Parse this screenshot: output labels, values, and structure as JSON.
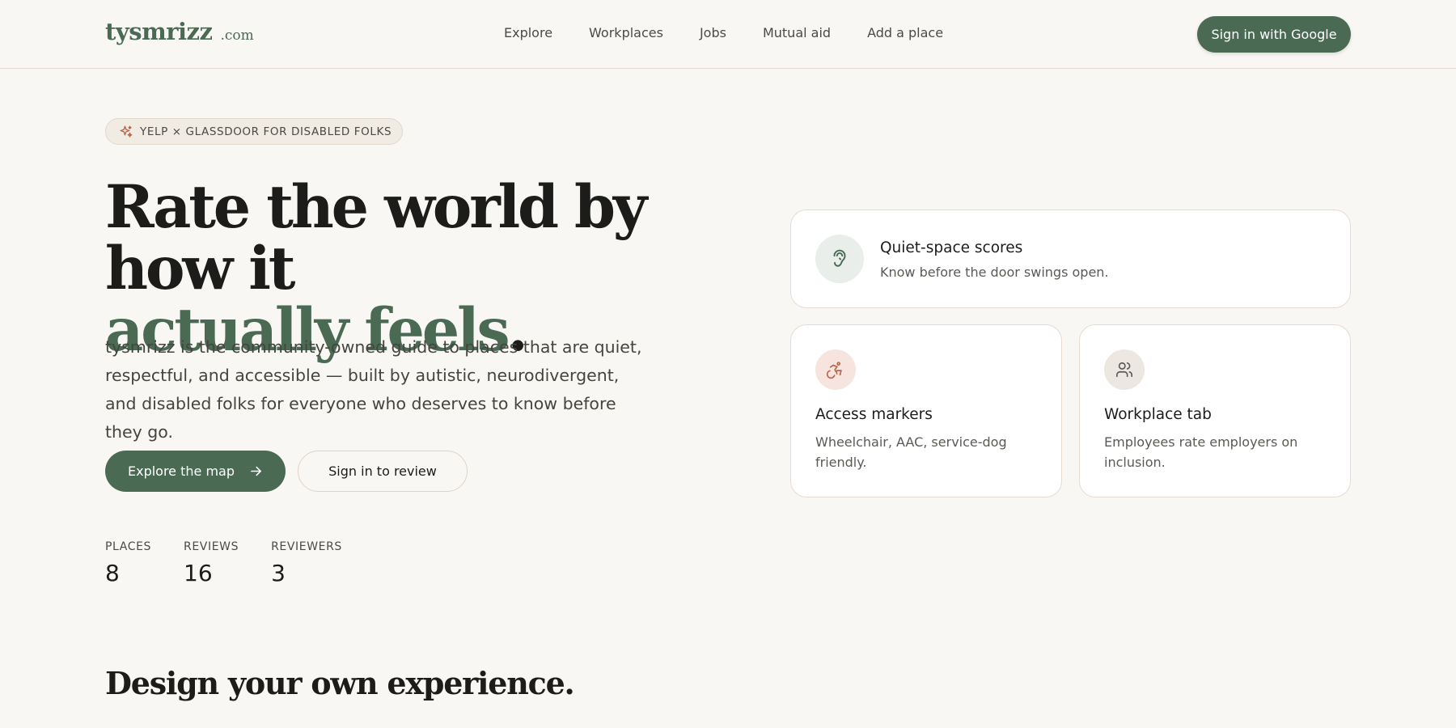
{
  "header": {
    "logo_name": "tysmrizz",
    "logo_tld": ".com",
    "nav": [
      "Explore",
      "Workplaces",
      "Jobs",
      "Mutual aid",
      "Add a place"
    ],
    "signin_label": "Sign in with Google"
  },
  "hero": {
    "badge": "YELP × GLASSDOOR FOR DISABLED FOLKS",
    "title_line1": "Rate the world by how it",
    "title_accent": "actually feels",
    "title_period": ".",
    "description": "tysmrizz is the community-owned guide to places that are quiet, respectful, and accessible — built by autistic, neurodivergent, and disabled folks for everyone who deserves to know before they go.",
    "explore_button": "Explore the map",
    "review_button": "Sign in to review",
    "stats": [
      {
        "label": "PLACES",
        "value": "8"
      },
      {
        "label": "REVIEWS",
        "value": "16"
      },
      {
        "label": "REVIEWERS",
        "value": "3"
      }
    ]
  },
  "features": [
    {
      "title": "Quiet-space scores",
      "text": "Know before the door swings open.",
      "icon": "ear-icon"
    },
    {
      "title": "Access markers",
      "text": "Wheelchair, AAC, service-dog friendly.",
      "icon": "accessibility-icon"
    },
    {
      "title": "Workplace tab",
      "text": "Employees rate employers on inclusion.",
      "icon": "users-icon"
    }
  ],
  "section": {
    "title": "Design your own experience."
  },
  "colors": {
    "background": "#f9f7f3",
    "brand_green": "#4a6a54",
    "accent_rust": "#b5654a",
    "border": "#e6dbd2"
  }
}
